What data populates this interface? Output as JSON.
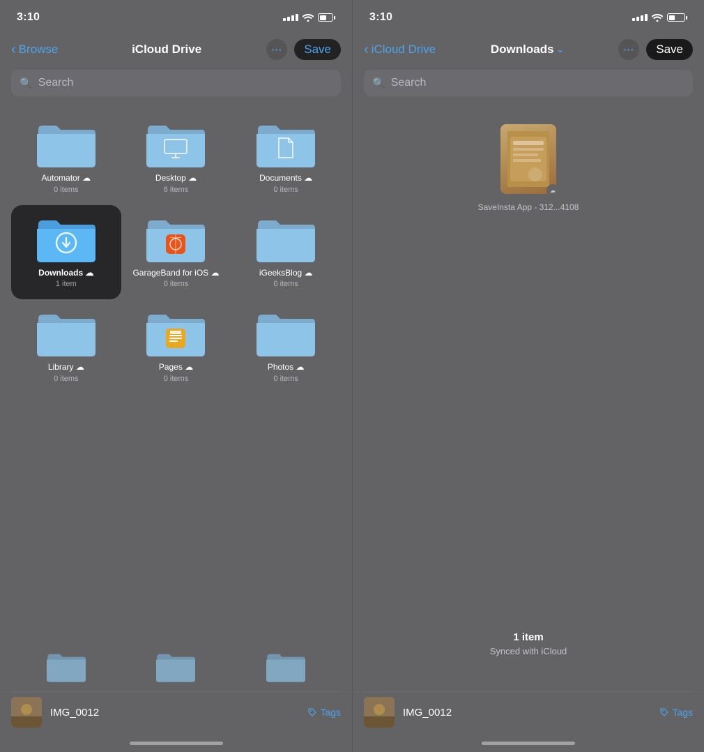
{
  "left_panel": {
    "status": {
      "time": "3:10"
    },
    "nav": {
      "back_label": "Browse",
      "title": "iCloud Drive",
      "dots_label": "···",
      "save_label": "Save"
    },
    "search": {
      "placeholder": "Search"
    },
    "files": [
      {
        "id": "automator",
        "name": "Automator",
        "meta": "0 items",
        "has_icloud": true,
        "selected": false,
        "type": "folder",
        "color": "#7EB3D8"
      },
      {
        "id": "desktop",
        "name": "Desktop",
        "meta": "6 items",
        "has_icloud": true,
        "selected": false,
        "type": "folder",
        "color": "#7EB3D8"
      },
      {
        "id": "documents",
        "name": "Documents",
        "meta": "0 items",
        "has_icloud": true,
        "selected": false,
        "type": "folder",
        "color": "#7EB3D8"
      },
      {
        "id": "downloads",
        "name": "Downloads",
        "meta": "1 item",
        "has_icloud": true,
        "selected": true,
        "type": "folder_download",
        "color": "#4DA3E8"
      },
      {
        "id": "garageband",
        "name": "GarageBand for iOS",
        "meta": "0 items",
        "has_icloud": true,
        "selected": false,
        "type": "app_folder",
        "color": "#7EB3D8",
        "app_icon": "garageband"
      },
      {
        "id": "igeeksblog",
        "name": "iGeeksBlog",
        "meta": "0 items",
        "has_icloud": true,
        "selected": false,
        "type": "folder",
        "color": "#7EB3D8"
      },
      {
        "id": "library",
        "name": "Library",
        "meta": "0 items",
        "has_icloud": true,
        "selected": false,
        "type": "folder",
        "color": "#7EB3D8"
      },
      {
        "id": "pages",
        "name": "Pages",
        "meta": "0 items",
        "has_icloud": true,
        "selected": false,
        "type": "app_folder",
        "color": "#7EB3D8",
        "app_icon": "pages"
      },
      {
        "id": "photos",
        "name": "Photos",
        "meta": "0 items",
        "has_icloud": true,
        "selected": false,
        "type": "folder",
        "color": "#7EB3D8"
      }
    ],
    "bottom": {
      "filename": "IMG_0012",
      "tags_label": "Tags"
    }
  },
  "right_panel": {
    "status": {
      "time": "3:10"
    },
    "nav": {
      "back_label": "iCloud Drive",
      "title": "Downloads",
      "dots_label": "···",
      "save_label": "Save"
    },
    "search": {
      "placeholder": "Search"
    },
    "file_name": "SaveInsta App - 312...4108",
    "stats": {
      "items": "1 item",
      "synced": "Synced with iCloud"
    },
    "bottom": {
      "filename": "IMG_0012",
      "tags_label": "Tags"
    }
  },
  "colors": {
    "accent": "#4DA3E8",
    "background": "#636366",
    "folder_blue": "#7EB3D8",
    "folder_blue_dark": "#5B9CC4",
    "selected_bg": "#1a1a1a",
    "text_primary": "#ffffff",
    "text_secondary": "rgba(235,235,245,0.6)"
  }
}
